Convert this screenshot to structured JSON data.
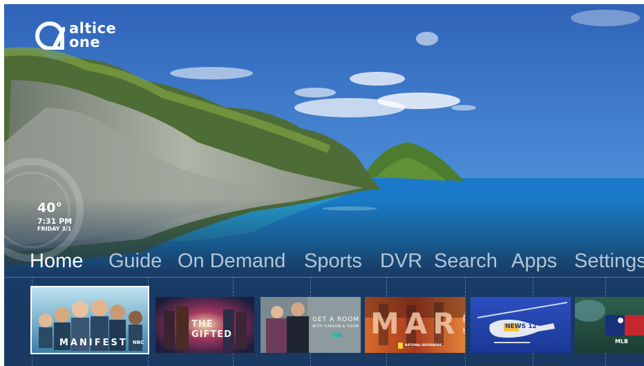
{
  "brand": {
    "line1": "altice",
    "line2": "one"
  },
  "weather": {
    "temperature": "40°",
    "time": "7:31 PM",
    "date": "FRIDAY 3/1"
  },
  "nav": {
    "items": [
      {
        "label": "Home",
        "active": true
      },
      {
        "label": "Guide"
      },
      {
        "label": "On Demand"
      },
      {
        "label": "Sports"
      },
      {
        "label": "DVR"
      },
      {
        "label": "Search"
      },
      {
        "label": "Apps"
      },
      {
        "label": "Settings"
      }
    ]
  },
  "tiles": [
    {
      "title": "MANIFEST",
      "network": "NBC"
    },
    {
      "title": "THE GIFTED"
    },
    {
      "title": "GET A ROOM",
      "subtitle": "WITH CARSON & THOM"
    },
    {
      "title": "MARS",
      "network": "NATIONAL GEOGRAPHIC"
    },
    {
      "title": "NEWS 12"
    },
    {
      "title": "MLB"
    }
  ],
  "colors": {
    "background": "#1b3a5e",
    "accent": "#ffffff",
    "nav_inactive": "#cfdce8"
  }
}
